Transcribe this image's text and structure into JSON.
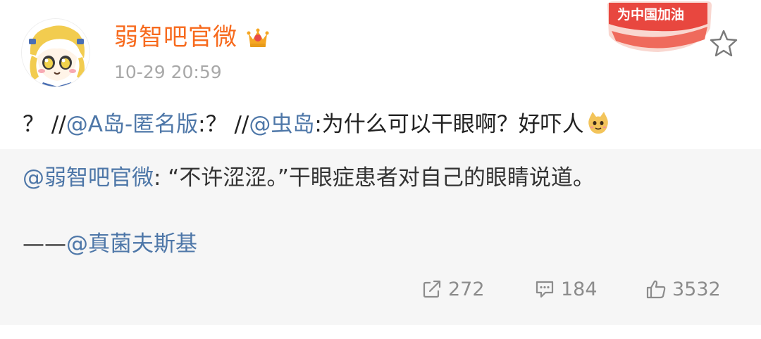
{
  "post": {
    "author": "弱智吧官微",
    "timestamp": "10-29 20:59",
    "badge_text": "为中国加油",
    "text_parts": {
      "p1": "？ //",
      "mention1": "@A岛-匿名版",
      "p2": ":？ //",
      "mention2": "@虫岛",
      "p3": ":为什么可以干眼啊？好吓人"
    }
  },
  "quote": {
    "author_mention": "@弱智吧官微",
    "text": ": “不许涩涩。”干眼症患者对自己的眼睛说道。",
    "signature_dash": "——",
    "signature_mention": "@真菌夫斯基"
  },
  "actions": {
    "reposts": "272",
    "comments": "184",
    "likes": "3532"
  },
  "icons": {
    "avatar": "cartoon-girl-avatar",
    "verified": "crown-icon",
    "favorite": "star-icon",
    "emoji": "cat-emoji-icon",
    "repost": "repost-icon",
    "comment": "comment-icon",
    "like": "thumbs-up-icon"
  },
  "colors": {
    "author_name": "#f76a1d",
    "mention": "#4e77a8",
    "timestamp": "#a8a8a8",
    "quote_background": "#f6f6f6",
    "action_text": "#8c8c8c",
    "badge_red": "#e8473f"
  }
}
